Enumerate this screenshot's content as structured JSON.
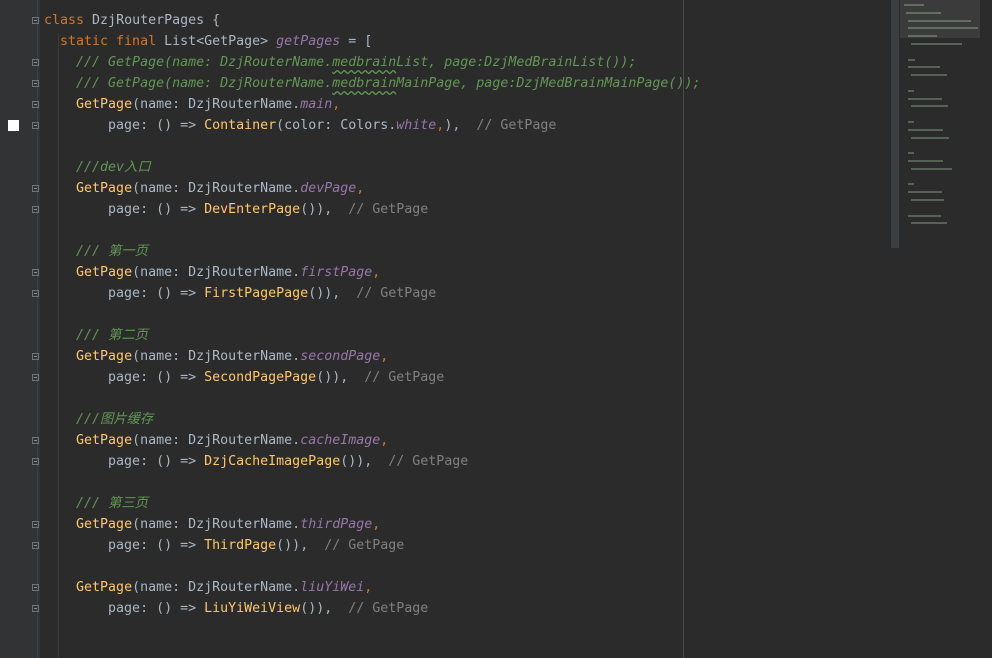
{
  "editor": {
    "language": "dart",
    "colors": {
      "background": "#2b2b2b",
      "gutter": "#313335",
      "keyword": "#cc7832",
      "function": "#ffc66d",
      "field": "#9876aa",
      "doc_comment": "#629755",
      "comment": "#808080",
      "default_text": "#a9b7c6"
    },
    "lines": [
      [
        {
          "t": "class ",
          "c": "kw"
        },
        {
          "t": "DzjRouterPages {",
          "c": "pl"
        }
      ],
      [
        {
          "t": "  static final ",
          "c": "kw"
        },
        {
          "t": "List<GetPage> ",
          "c": "pl"
        },
        {
          "t": "getPages",
          "c": "fld"
        },
        {
          "t": " = [",
          "c": "pl"
        }
      ],
      [
        {
          "t": "    /// GetPage(name: DzjRouterName.",
          "c": "doc"
        },
        {
          "t": "medbrain",
          "c": "doc squig"
        },
        {
          "t": "List, page:DzjMedBrainList());",
          "c": "doc"
        }
      ],
      [
        {
          "t": "    /// GetPage(name: DzjRouterName.",
          "c": "doc"
        },
        {
          "t": "medbrain",
          "c": "doc squig"
        },
        {
          "t": "MainPage, page:DzjMedBrainMainPage());",
          "c": "doc"
        }
      ],
      [
        {
          "t": "    ",
          "c": "pl"
        },
        {
          "t": "GetPage",
          "c": "fn"
        },
        {
          "t": "(name: DzjRouterName.",
          "c": "pl"
        },
        {
          "t": "main",
          "c": "fld"
        },
        {
          "t": ",",
          "c": "punc"
        }
      ],
      [
        {
          "t": "        page: () => ",
          "c": "pl"
        },
        {
          "t": "Container",
          "c": "fn"
        },
        {
          "t": "(color: Colors.",
          "c": "pl"
        },
        {
          "t": "white",
          "c": "fld"
        },
        {
          "t": ",",
          "c": "punc"
        },
        {
          "t": "),",
          "c": "pl"
        },
        {
          "t": "  ",
          "c": "pl"
        },
        {
          "t": "// GetPage",
          "c": "cm"
        }
      ],
      [],
      [
        {
          "t": "    ///dev入口",
          "c": "doc"
        }
      ],
      [
        {
          "t": "    ",
          "c": "pl"
        },
        {
          "t": "GetPage",
          "c": "fn"
        },
        {
          "t": "(name: DzjRouterName.",
          "c": "pl"
        },
        {
          "t": "devPage",
          "c": "fld"
        },
        {
          "t": ",",
          "c": "punc"
        }
      ],
      [
        {
          "t": "        page: () => ",
          "c": "pl"
        },
        {
          "t": "DevEnterPage",
          "c": "fn"
        },
        {
          "t": "()),",
          "c": "pl"
        },
        {
          "t": "  ",
          "c": "pl"
        },
        {
          "t": "// GetPage",
          "c": "cm"
        }
      ],
      [],
      [
        {
          "t": "    /// 第一页",
          "c": "doc"
        }
      ],
      [
        {
          "t": "    ",
          "c": "pl"
        },
        {
          "t": "GetPage",
          "c": "fn"
        },
        {
          "t": "(name: DzjRouterName.",
          "c": "pl"
        },
        {
          "t": "firstPage",
          "c": "fld"
        },
        {
          "t": ",",
          "c": "punc"
        }
      ],
      [
        {
          "t": "        page: () => ",
          "c": "pl"
        },
        {
          "t": "FirstPagePage",
          "c": "fn"
        },
        {
          "t": "()),",
          "c": "pl"
        },
        {
          "t": "  ",
          "c": "pl"
        },
        {
          "t": "// GetPage",
          "c": "cm"
        }
      ],
      [],
      [
        {
          "t": "    /// 第二页",
          "c": "doc"
        }
      ],
      [
        {
          "t": "    ",
          "c": "pl"
        },
        {
          "t": "GetPage",
          "c": "fn"
        },
        {
          "t": "(name: DzjRouterName.",
          "c": "pl"
        },
        {
          "t": "secondPage",
          "c": "fld"
        },
        {
          "t": ",",
          "c": "punc"
        }
      ],
      [
        {
          "t": "        page: () => ",
          "c": "pl"
        },
        {
          "t": "SecondPagePage",
          "c": "fn"
        },
        {
          "t": "()),",
          "c": "pl"
        },
        {
          "t": "  ",
          "c": "pl"
        },
        {
          "t": "// GetPage",
          "c": "cm"
        }
      ],
      [],
      [
        {
          "t": "    ///图片缓存",
          "c": "doc"
        }
      ],
      [
        {
          "t": "    ",
          "c": "pl"
        },
        {
          "t": "GetPage",
          "c": "fn"
        },
        {
          "t": "(name: DzjRouterName.",
          "c": "pl"
        },
        {
          "t": "cacheImage",
          "c": "fld"
        },
        {
          "t": ",",
          "c": "punc"
        }
      ],
      [
        {
          "t": "        page: () => ",
          "c": "pl"
        },
        {
          "t": "DzjCacheImagePage",
          "c": "fn"
        },
        {
          "t": "()),",
          "c": "pl"
        },
        {
          "t": "  ",
          "c": "pl"
        },
        {
          "t": "// GetPage",
          "c": "cm"
        }
      ],
      [],
      [
        {
          "t": "    /// 第三页",
          "c": "doc"
        }
      ],
      [
        {
          "t": "    ",
          "c": "pl"
        },
        {
          "t": "GetPage",
          "c": "fn"
        },
        {
          "t": "(name: DzjRouterName.",
          "c": "pl"
        },
        {
          "t": "thirdPage",
          "c": "fld"
        },
        {
          "t": ",",
          "c": "punc"
        }
      ],
      [
        {
          "t": "        page: () => ",
          "c": "pl"
        },
        {
          "t": "ThirdPage",
          "c": "fn"
        },
        {
          "t": "()),",
          "c": "pl"
        },
        {
          "t": "  ",
          "c": "pl"
        },
        {
          "t": "// GetPage",
          "c": "cm"
        }
      ],
      [],
      [
        {
          "t": "    ",
          "c": "pl"
        },
        {
          "t": "GetPage",
          "c": "fn"
        },
        {
          "t": "(name: DzjRouterName.",
          "c": "pl"
        },
        {
          "t": "liuYiWei",
          "c": "fld"
        },
        {
          "t": ",",
          "c": "punc"
        }
      ],
      [
        {
          "t": "        page: () => ",
          "c": "pl"
        },
        {
          "t": "LiuYiWeiView",
          "c": "fn"
        },
        {
          "t": "()),",
          "c": "pl"
        },
        {
          "t": "  ",
          "c": "pl"
        },
        {
          "t": "// GetPage",
          "c": "cm"
        }
      ]
    ],
    "fold_lines": [
      0,
      2,
      3,
      4,
      5,
      8,
      9,
      12,
      13,
      16,
      17,
      20,
      21,
      24,
      25,
      27,
      28
    ]
  }
}
